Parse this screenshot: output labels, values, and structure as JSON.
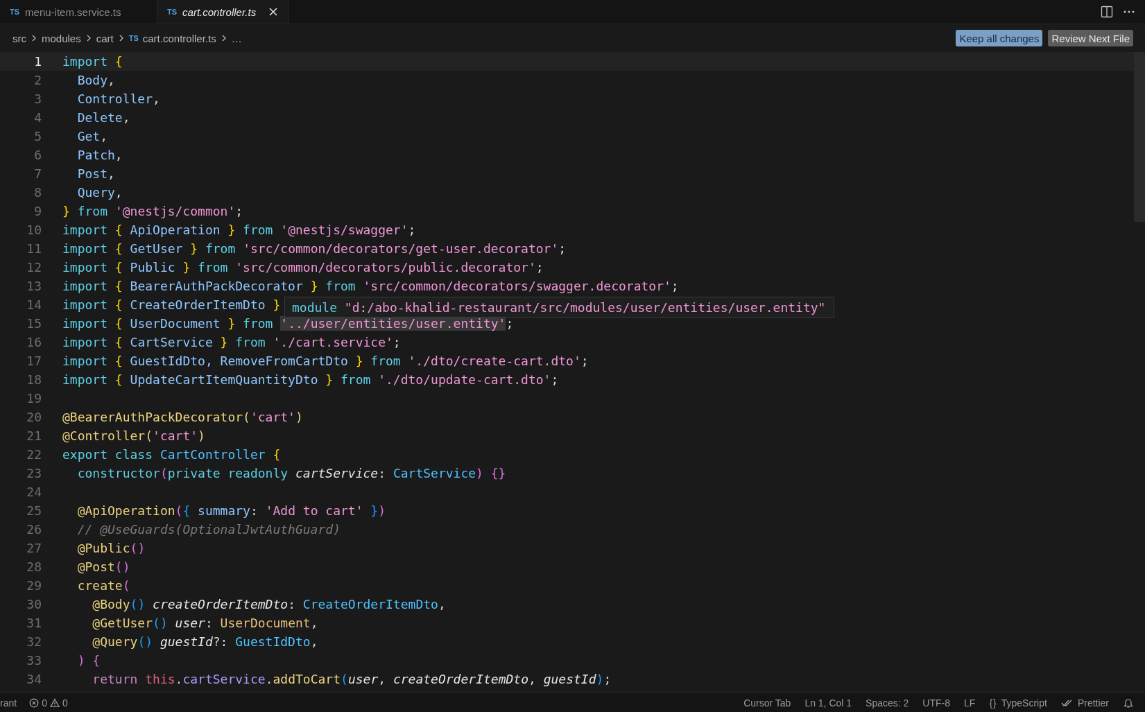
{
  "tabs": [
    {
      "badge": "TS",
      "label": "menu-item.service.ts",
      "selected": false,
      "preview": false,
      "closable": false
    },
    {
      "badge": "TS",
      "label": "cart.controller.ts",
      "selected": true,
      "preview": true,
      "closable": true
    }
  ],
  "editor_actions": [
    {
      "kind": "split"
    },
    {
      "kind": "more"
    }
  ],
  "breadcrumb": [
    {
      "label": "src",
      "kind": "folder"
    },
    {
      "label": "modules",
      "kind": "folder"
    },
    {
      "label": "cart",
      "kind": "folder"
    },
    {
      "label": "cart.controller.ts",
      "kind": "file",
      "badge": "TS"
    },
    {
      "label": "…",
      "kind": "more"
    }
  ],
  "review_buttons": [
    {
      "label": "Keep all changes",
      "kind": "primary"
    },
    {
      "label": "Review Next File",
      "kind": "secondary"
    }
  ],
  "lines": [
    {
      "number": "1",
      "current": true,
      "tokens": [
        {
          "text": "import ",
          "kind": "keyword"
        },
        {
          "text": "{",
          "kind": "brace"
        }
      ]
    },
    {
      "number": "2",
      "current": false,
      "tokens": [
        {
          "text": "  Body",
          "kind": "name"
        },
        {
          "text": ",",
          "kind": "plain"
        }
      ]
    },
    {
      "number": "3",
      "current": false,
      "tokens": [
        {
          "text": "  Controller",
          "kind": "name"
        },
        {
          "text": ",",
          "kind": "plain"
        }
      ]
    },
    {
      "number": "4",
      "current": false,
      "tokens": [
        {
          "text": "  Delete",
          "kind": "name"
        },
        {
          "text": ",",
          "kind": "plain"
        }
      ]
    },
    {
      "number": "5",
      "current": false,
      "tokens": [
        {
          "text": "  Get",
          "kind": "name"
        },
        {
          "text": ",",
          "kind": "plain"
        }
      ]
    },
    {
      "number": "6",
      "current": false,
      "tokens": [
        {
          "text": "  Patch",
          "kind": "name"
        },
        {
          "text": ",",
          "kind": "plain"
        }
      ]
    },
    {
      "number": "7",
      "current": false,
      "tokens": [
        {
          "text": "  Post",
          "kind": "name"
        },
        {
          "text": ",",
          "kind": "plain"
        }
      ]
    },
    {
      "number": "8",
      "current": false,
      "tokens": [
        {
          "text": "  Query",
          "kind": "name"
        },
        {
          "text": ",",
          "kind": "plain"
        }
      ]
    },
    {
      "number": "9",
      "current": false,
      "tokens": [
        {
          "text": "}",
          "kind": "brace"
        },
        {
          "text": " from ",
          "kind": "keyword"
        },
        {
          "text": "'@nestjs/common'",
          "kind": "string"
        },
        {
          "text": ";",
          "kind": "plain"
        }
      ]
    },
    {
      "number": "10",
      "current": false,
      "tokens": [
        {
          "text": "import ",
          "kind": "keyword"
        },
        {
          "text": "{",
          "kind": "brace"
        },
        {
          "text": " ApiOperation ",
          "kind": "name"
        },
        {
          "text": "}",
          "kind": "brace"
        },
        {
          "text": " from ",
          "kind": "keyword"
        },
        {
          "text": "'@nestjs/swagger'",
          "kind": "string"
        },
        {
          "text": ";",
          "kind": "plain"
        }
      ]
    },
    {
      "number": "11",
      "current": false,
      "tokens": [
        {
          "text": "import ",
          "kind": "keyword"
        },
        {
          "text": "{",
          "kind": "brace"
        },
        {
          "text": " GetUser ",
          "kind": "name"
        },
        {
          "text": "}",
          "kind": "brace"
        },
        {
          "text": " from ",
          "kind": "keyword"
        },
        {
          "text": "'src/common/decorators/get-user.decorator'",
          "kind": "string"
        },
        {
          "text": ";",
          "kind": "plain"
        }
      ]
    },
    {
      "number": "12",
      "current": false,
      "tokens": [
        {
          "text": "import ",
          "kind": "keyword"
        },
        {
          "text": "{",
          "kind": "brace"
        },
        {
          "text": " Public ",
          "kind": "name"
        },
        {
          "text": "}",
          "kind": "brace"
        },
        {
          "text": " from ",
          "kind": "keyword"
        },
        {
          "text": "'src/common/decorators/public.decorator'",
          "kind": "string"
        },
        {
          "text": ";",
          "kind": "plain"
        }
      ]
    },
    {
      "number": "13",
      "current": false,
      "tokens": [
        {
          "text": "import ",
          "kind": "keyword"
        },
        {
          "text": "{",
          "kind": "brace"
        },
        {
          "text": " BearerAuthPackDecorator ",
          "kind": "name"
        },
        {
          "text": "}",
          "kind": "brace"
        },
        {
          "text": " from ",
          "kind": "keyword"
        },
        {
          "text": "'src/common/decorators/swagger.decorator'",
          "kind": "string"
        },
        {
          "text": ";",
          "kind": "plain"
        }
      ]
    },
    {
      "number": "14",
      "current": false,
      "tokens": [
        {
          "text": "import ",
          "kind": "keyword"
        },
        {
          "text": "{",
          "kind": "brace"
        },
        {
          "text": " CreateOrderItemDto ",
          "kind": "name"
        },
        {
          "text": "}",
          "kind": "brace"
        }
      ]
    },
    {
      "number": "15",
      "current": false,
      "tokens": [
        {
          "text": "import ",
          "kind": "keyword"
        },
        {
          "text": "{",
          "kind": "brace"
        },
        {
          "text": " UserDocument ",
          "kind": "name"
        },
        {
          "text": "}",
          "kind": "brace"
        },
        {
          "text": " from ",
          "kind": "keyword"
        },
        {
          "text": "'../user/entities/user.entity'",
          "kind": "hovered"
        },
        {
          "text": ";",
          "kind": "plain"
        }
      ]
    },
    {
      "number": "16",
      "current": false,
      "tokens": [
        {
          "text": "import ",
          "kind": "keyword"
        },
        {
          "text": "{",
          "kind": "brace"
        },
        {
          "text": " CartService ",
          "kind": "name"
        },
        {
          "text": "}",
          "kind": "brace"
        },
        {
          "text": " from ",
          "kind": "keyword"
        },
        {
          "text": "'./cart.service'",
          "kind": "string"
        },
        {
          "text": ";",
          "kind": "plain"
        }
      ]
    },
    {
      "number": "17",
      "current": false,
      "tokens": [
        {
          "text": "import ",
          "kind": "keyword"
        },
        {
          "text": "{",
          "kind": "brace"
        },
        {
          "text": " GuestIdDto, RemoveFromCartDto ",
          "kind": "name"
        },
        {
          "text": "}",
          "kind": "brace"
        },
        {
          "text": " from ",
          "kind": "keyword"
        },
        {
          "text": "'./dto/create-cart.dto'",
          "kind": "string"
        },
        {
          "text": ";",
          "kind": "plain"
        }
      ]
    },
    {
      "number": "18",
      "current": false,
      "tokens": [
        {
          "text": "import ",
          "kind": "keyword"
        },
        {
          "text": "{",
          "kind": "brace"
        },
        {
          "text": " UpdateCartItemQuantityDto ",
          "kind": "name"
        },
        {
          "text": "}",
          "kind": "brace"
        },
        {
          "text": " from ",
          "kind": "keyword"
        },
        {
          "text": "'./dto/update-cart.dto'",
          "kind": "string"
        },
        {
          "text": ";",
          "kind": "plain"
        }
      ]
    },
    {
      "number": "19",
      "current": false
    },
    {
      "number": "20",
      "current": false,
      "tokens": [
        {
          "text": "@BearerAuthPackDecorator(",
          "kind": "decorator"
        },
        {
          "text": "'cart'",
          "kind": "string"
        },
        {
          "text": ")",
          "kind": "decorator"
        }
      ]
    },
    {
      "number": "21",
      "current": false,
      "tokens": [
        {
          "text": "@Controller(",
          "kind": "decorator"
        },
        {
          "text": "'cart'",
          "kind": "string"
        },
        {
          "text": ")",
          "kind": "decorator"
        }
      ]
    },
    {
      "number": "22",
      "current": false,
      "tokens": [
        {
          "text": "export class ",
          "kind": "keyword"
        },
        {
          "text": "CartController ",
          "kind": "type"
        },
        {
          "text": "{",
          "kind": "brace"
        }
      ]
    },
    {
      "number": "23",
      "current": false,
      "tokens": [
        {
          "text": "  constructor",
          "kind": "keyword"
        },
        {
          "text": "(",
          "kind": "paren"
        },
        {
          "text": "private readonly ",
          "kind": "keyword"
        },
        {
          "text": "cartService",
          "kind": "param"
        },
        {
          "text": ": ",
          "kind": "plain"
        },
        {
          "text": "CartService",
          "kind": "type"
        },
        {
          "text": ") {}",
          "kind": "paren"
        }
      ]
    },
    {
      "number": "24",
      "current": false
    },
    {
      "number": "25",
      "current": false,
      "tokens": [
        {
          "text": "  @ApiOperation",
          "kind": "decorator"
        },
        {
          "text": "(",
          "kind": "paren"
        },
        {
          "text": "{",
          "kind": "bracket"
        },
        {
          "text": " summary",
          "kind": "prop"
        },
        {
          "text": ": ",
          "kind": "plain"
        },
        {
          "text": "'Add to cart' ",
          "kind": "string"
        },
        {
          "text": "}",
          "kind": "bracket"
        },
        {
          "text": ")",
          "kind": "paren"
        }
      ]
    },
    {
      "number": "26",
      "current": false,
      "tokens": [
        {
          "text": "  // @UseGuards(OptionalJwtAuthGuard)",
          "kind": "comment"
        }
      ]
    },
    {
      "number": "27",
      "current": false,
      "tokens": [
        {
          "text": "  @Public",
          "kind": "decorator"
        },
        {
          "text": "()",
          "kind": "paren"
        }
      ]
    },
    {
      "number": "28",
      "current": false,
      "tokens": [
        {
          "text": "  @Post",
          "kind": "decorator"
        },
        {
          "text": "()",
          "kind": "paren"
        }
      ]
    },
    {
      "number": "29",
      "current": false,
      "tokens": [
        {
          "text": "  create",
          "kind": "decorator"
        },
        {
          "text": "(",
          "kind": "paren"
        }
      ]
    },
    {
      "number": "30",
      "current": false,
      "tokens": [
        {
          "text": "    @Body",
          "kind": "decorator"
        },
        {
          "text": "() ",
          "kind": "bracket"
        },
        {
          "text": "createOrderItemDto",
          "kind": "param"
        },
        {
          "text": ": ",
          "kind": "plain"
        },
        {
          "text": "CreateOrderItemDto",
          "kind": "type"
        },
        {
          "text": ",",
          "kind": "plain"
        }
      ]
    },
    {
      "number": "31",
      "current": false,
      "tokens": [
        {
          "text": "    @GetUser",
          "kind": "decorator"
        },
        {
          "text": "() ",
          "kind": "bracket"
        },
        {
          "text": "user",
          "kind": "param"
        },
        {
          "text": ": ",
          "kind": "plain"
        },
        {
          "text": "UserDocument",
          "kind": "alias"
        },
        {
          "text": ",",
          "kind": "plain"
        }
      ]
    },
    {
      "number": "32",
      "current": false,
      "tokens": [
        {
          "text": "    @Query",
          "kind": "decorator"
        },
        {
          "text": "() ",
          "kind": "bracket"
        },
        {
          "text": "guestId",
          "kind": "param"
        },
        {
          "text": "?: ",
          "kind": "plain"
        },
        {
          "text": "GuestIdDto",
          "kind": "type"
        },
        {
          "text": ",",
          "kind": "plain"
        }
      ]
    },
    {
      "number": "33",
      "current": false,
      "tokens": [
        {
          "text": "  ) {",
          "kind": "paren"
        }
      ]
    },
    {
      "number": "34",
      "current": false,
      "tokens": [
        {
          "text": "    return ",
          "kind": "control"
        },
        {
          "text": "this",
          "kind": "this"
        },
        {
          "text": ".",
          "kind": "plain"
        },
        {
          "text": "cartService",
          "kind": "member"
        },
        {
          "text": ".",
          "kind": "plain"
        },
        {
          "text": "addToCart",
          "kind": "decorator"
        },
        {
          "text": "(",
          "kind": "bracket"
        },
        {
          "text": "user",
          "kind": "param"
        },
        {
          "text": ", ",
          "kind": "plain"
        },
        {
          "text": "createOrderItemDto",
          "kind": "param"
        },
        {
          "text": ", ",
          "kind": "plain"
        },
        {
          "text": "guestId",
          "kind": "param"
        },
        {
          "text": ")",
          "kind": "bracket"
        },
        {
          "text": ";",
          "kind": "plain"
        }
      ]
    }
  ],
  "hover_tooltip": {
    "keyword": "module",
    "path": "\"d:/abo-khalid-restaurant/src/modules/user/entities/user.entity\""
  },
  "status_bar": {
    "left_text": "rant",
    "errors": "0",
    "warnings": "0",
    "items": [
      {
        "label": "Cursor Tab"
      },
      {
        "label": "Ln 1, Col 1"
      },
      {
        "label": "Spaces: 2"
      },
      {
        "label": "UTF-8"
      },
      {
        "label": "LF"
      },
      {
        "label": "TypeScript",
        "glyph": "{}"
      },
      {
        "label": "Prettier",
        "kind": "checks"
      },
      {
        "kind": "bell"
      }
    ]
  }
}
